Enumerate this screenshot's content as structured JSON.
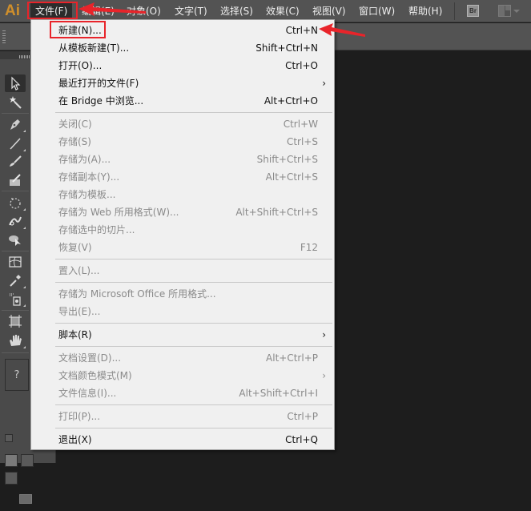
{
  "app": {
    "logo": "Ai"
  },
  "menubar": {
    "items": [
      {
        "label": "文件(F)",
        "active": true
      },
      {
        "label": "编辑(E)"
      },
      {
        "label": "对象(O)"
      },
      {
        "label": "文字(T)"
      },
      {
        "label": "选择(S)"
      },
      {
        "label": "效果(C)"
      },
      {
        "label": "视图(V)"
      },
      {
        "label": "窗口(W)"
      },
      {
        "label": "帮助(H)"
      }
    ],
    "bridge_button": "Br",
    "workspace_icon": "workspace-layout-icon"
  },
  "tools": [
    {
      "name": "selection-tool",
      "icon": "arrow-cursor-icon"
    },
    {
      "name": "magic-wand-tool",
      "icon": "magic-wand-icon"
    },
    {
      "name": "pen-tool",
      "icon": "pen-icon"
    },
    {
      "name": "line-tool",
      "icon": "line-icon"
    },
    {
      "name": "paintbrush-tool",
      "icon": "brush-icon"
    },
    {
      "name": "blob-brush-tool",
      "icon": "blob-brush-icon"
    },
    {
      "name": "rotate-tool",
      "icon": "rotate-icon"
    },
    {
      "name": "puppet-warp-tool",
      "icon": "warp-icon"
    },
    {
      "name": "shape-builder-tool",
      "icon": "shape-builder-icon"
    },
    {
      "name": "mesh-tool",
      "icon": "mesh-icon"
    },
    {
      "name": "eyedropper-tool",
      "icon": "eyedropper-icon"
    },
    {
      "name": "symbol-sprayer-tool",
      "icon": "sprayer-icon"
    },
    {
      "name": "artboard-tool",
      "icon": "artboard-icon"
    },
    {
      "name": "hand-tool",
      "icon": "hand-icon"
    }
  ],
  "color_box": {
    "label": "?"
  },
  "file_menu": {
    "items": [
      {
        "label": "新建(N)...",
        "shortcut": "Ctrl+N",
        "enabled": true,
        "highlighted": true
      },
      {
        "label": "从模板新建(T)...",
        "shortcut": "Shift+Ctrl+N",
        "enabled": true
      },
      {
        "label": "打开(O)...",
        "shortcut": "Ctrl+O",
        "enabled": true
      },
      {
        "label": "最近打开的文件(F)",
        "shortcut": "",
        "enabled": true,
        "submenu": true
      },
      {
        "label": "在 Bridge 中浏览...",
        "shortcut": "Alt+Ctrl+O",
        "enabled": true
      },
      {
        "separator": true
      },
      {
        "label": "关闭(C)",
        "shortcut": "Ctrl+W",
        "enabled": false
      },
      {
        "label": "存储(S)",
        "shortcut": "Ctrl+S",
        "enabled": false
      },
      {
        "label": "存储为(A)...",
        "shortcut": "Shift+Ctrl+S",
        "enabled": false
      },
      {
        "label": "存储副本(Y)...",
        "shortcut": "Alt+Ctrl+S",
        "enabled": false
      },
      {
        "label": "存储为模板...",
        "shortcut": "",
        "enabled": false
      },
      {
        "label": "存储为 Web 所用格式(W)...",
        "shortcut": "Alt+Shift+Ctrl+S",
        "enabled": false
      },
      {
        "label": "存储选中的切片...",
        "shortcut": "",
        "enabled": false
      },
      {
        "label": "恢复(V)",
        "shortcut": "F12",
        "enabled": false
      },
      {
        "separator": true
      },
      {
        "label": "置入(L)...",
        "shortcut": "",
        "enabled": false
      },
      {
        "separator": true
      },
      {
        "label": "存储为 Microsoft Office 所用格式...",
        "shortcut": "",
        "enabled": false
      },
      {
        "label": "导出(E)...",
        "shortcut": "",
        "enabled": false
      },
      {
        "separator": true
      },
      {
        "label": "脚本(R)",
        "shortcut": "",
        "enabled": true,
        "submenu": true
      },
      {
        "separator": true
      },
      {
        "label": "文档设置(D)...",
        "shortcut": "Alt+Ctrl+P",
        "enabled": false
      },
      {
        "label": "文档颜色模式(M)",
        "shortcut": "",
        "enabled": false,
        "submenu": true
      },
      {
        "label": "文件信息(I)...",
        "shortcut": "Alt+Shift+Ctrl+I",
        "enabled": false
      },
      {
        "separator": true
      },
      {
        "label": "打印(P)...",
        "shortcut": "Ctrl+P",
        "enabled": false
      },
      {
        "separator": true
      },
      {
        "label": "退出(X)",
        "shortcut": "Ctrl+Q",
        "enabled": true
      }
    ],
    "submenu_glyph": "›"
  },
  "annotations": {
    "color": "#e8242a"
  },
  "colors": {
    "accent_logo": "#d08f2b",
    "menubar_bg": "#535353",
    "menu_bg": "#f0f0f0"
  }
}
